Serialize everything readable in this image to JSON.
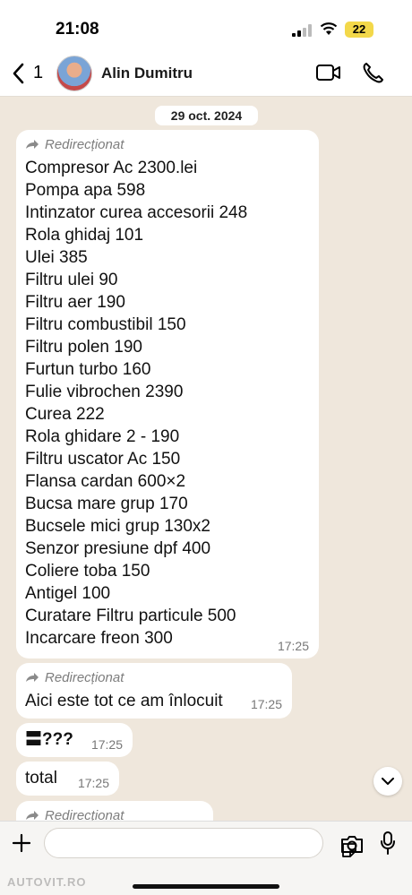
{
  "status_bar": {
    "time": "21:08",
    "battery": "22"
  },
  "header": {
    "back_count": "1",
    "contact_name": "Alin Dumitru"
  },
  "chat": {
    "date": "29 oct. 2024",
    "forwarded_label": "Redirecționat",
    "messages": [
      {
        "lines": [
          "Compresor Ac 2300.lei",
          "Pompa apa 598",
          "Intinzator curea accesorii 248",
          "Rola ghidaj 101",
          "Ulei 385",
          "Filtru ulei 90",
          "Filtru aer 190",
          "Filtru combustibil 150",
          "Filtru polen 190",
          "Furtun turbo 160",
          "Fulie vibrochen 2390",
          "Curea 222",
          "Rola ghidare 2 - 190",
          "Filtru uscator Ac 150",
          "Flansa cardan 600×2",
          "Bucsa mare grup 170",
          "Bucsele mici grup 130x2",
          "Senzor presiune dpf 400",
          "Coliere toba 150",
          "Antigel 100",
          "Curatare Filtru particule 500",
          "Incarcare freon 300"
        ],
        "time": "17:25"
      },
      {
        "text": "Aici este tot ce am înlocuit",
        "time": "17:25"
      },
      {
        "text": "〓???",
        "time": "17:25"
      },
      {
        "text": "total",
        "time": "17:25"
      }
    ]
  },
  "footer": {
    "watermark": "AUTOVIT.RO"
  },
  "colors": {
    "background": "#efe7dc",
    "bubble": "#ffffff",
    "battery": "#f3d84a"
  }
}
